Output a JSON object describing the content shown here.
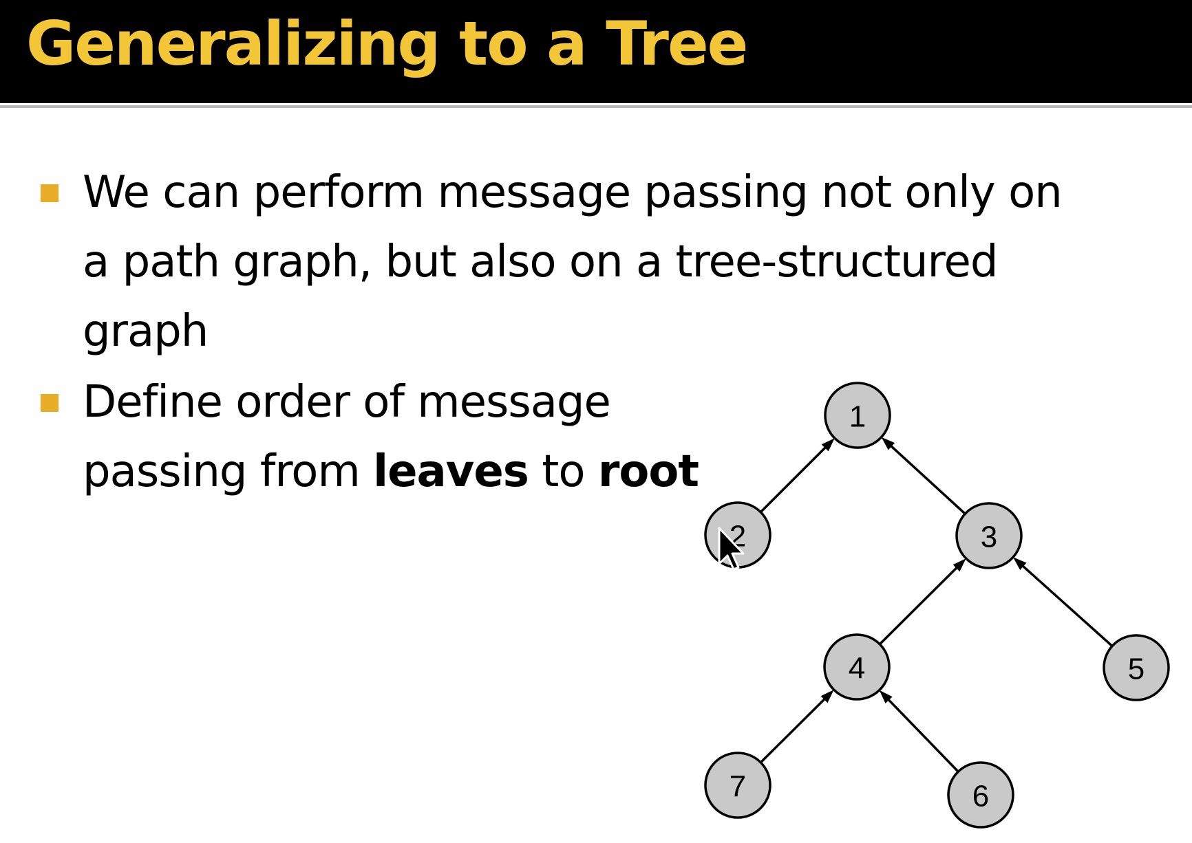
{
  "slide": {
    "title": "Generalizing to a Tree",
    "bullets": [
      {
        "lines": [
          "We can perform message passing not only on",
          "a path graph, but also on a tree-structured",
          "graph"
        ]
      },
      {
        "line1": "Define order of message",
        "line2_parts": {
          "p1": "passing from ",
          "b1": "leaves",
          "p2": " to ",
          "b2": "root"
        }
      }
    ]
  },
  "diagram": {
    "nodes": [
      {
        "id": "1",
        "label": "1"
      },
      {
        "id": "2",
        "label": "2"
      },
      {
        "id": "3",
        "label": "3"
      },
      {
        "id": "4",
        "label": "4"
      },
      {
        "id": "5",
        "label": "5"
      },
      {
        "id": "6",
        "label": "6"
      },
      {
        "id": "7",
        "label": "7"
      }
    ],
    "edges": [
      {
        "from": "2",
        "to": "1",
        "directed": true
      },
      {
        "from": "3",
        "to": "1",
        "directed": true
      },
      {
        "from": "4",
        "to": "3",
        "directed": true
      },
      {
        "from": "5",
        "to": "3",
        "directed": true
      },
      {
        "from": "7",
        "to": "4",
        "directed": true
      },
      {
        "from": "6",
        "to": "4",
        "directed": true
      }
    ],
    "colors": {
      "node_fill": "#c9c9c9",
      "node_stroke": "#000000",
      "title_color": "#f3c637",
      "bullet_color": "#e8ad27"
    }
  },
  "cursor": {
    "icon": "arrow-cursor-icon"
  }
}
